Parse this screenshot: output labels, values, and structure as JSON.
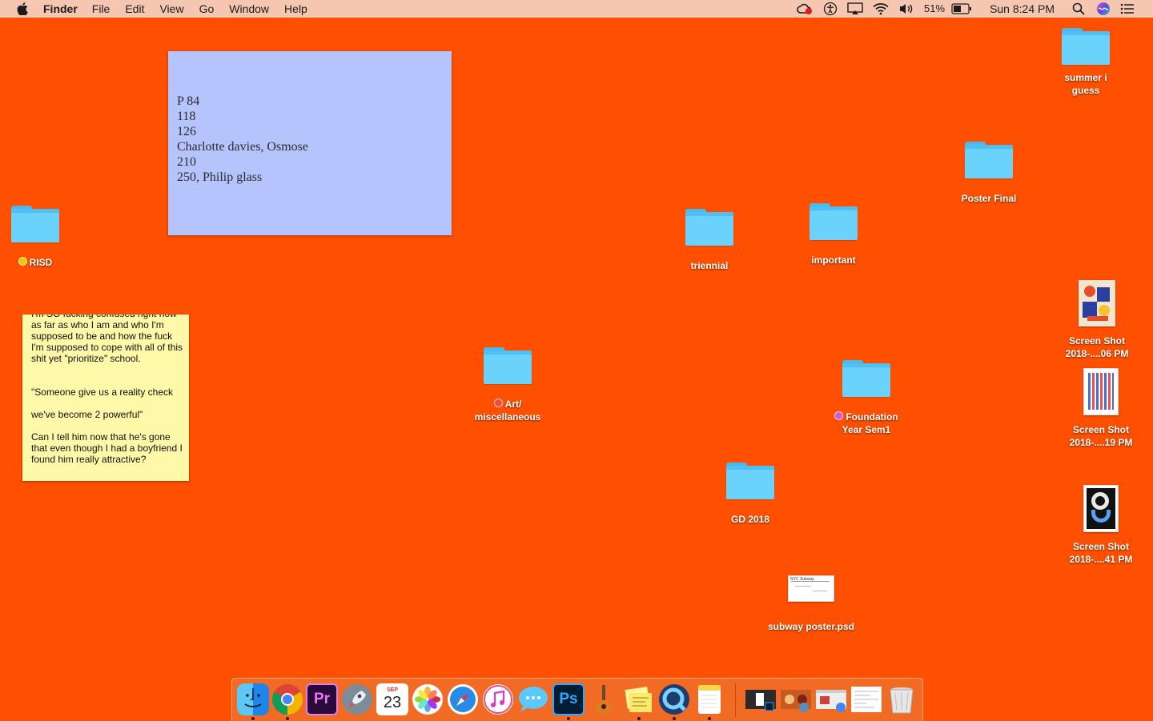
{
  "menubar": {
    "app_name": "Finder",
    "menus": [
      "File",
      "Edit",
      "View",
      "Go",
      "Window",
      "Help"
    ],
    "battery": "51%",
    "clock": "Sun 8:24 PM",
    "icons": [
      "apple-icon",
      "creative-cloud-icon",
      "accessibility-icon",
      "airplay-icon",
      "wifi-icon",
      "volume-icon",
      "battery-icon",
      "spotlight-search-icon",
      "siri-icon",
      "notification-center-icon"
    ]
  },
  "desktop": {
    "folders": {
      "summer": "summer i guess",
      "poster_final": "Poster Final",
      "risd": "RISD",
      "triennial": "triennial",
      "important": "important",
      "art": "Art/ miscellaneous",
      "foundation": "Foundation Year Sem1",
      "gd": "GD 2018"
    },
    "tag_colors": {
      "yellow": "#f6c700",
      "red": "#ef4a3c",
      "purple": "#d458d4"
    },
    "files": {
      "shot1": "Screen Shot 2018-....06 PM",
      "shot2": "Screen Shot 2018-....19 PM",
      "shot3": "Screen Shot 2018-....41 PM",
      "subway": "subway poster.psd",
      "subway_thumb_text": "NYC Subway"
    }
  },
  "stickies": {
    "blue_text": "P 84\n118\n126\nCharlotte davies, Osmose\n210\n250, Philip glass",
    "yellow_text": "I'm SO fucking confused right now as far as who I am and who I'm supposed to be and how the fuck I'm supposed to cope with all of this shit yet \"prioritize\" school.\n\n\n\"Someone give us a reality check\n\nwe've become 2 powerful\"\n\nCan I tell him now that he's gone that even though I had a boyfriend I found him really attractive?"
  },
  "dock": {
    "calendar_month": "SEP",
    "calendar_day": "23",
    "premiere_label": "Pr",
    "photoshop_label": "Ps",
    "apps": [
      "finder-icon",
      "chrome-icon",
      "premiere-icon",
      "launchpad-icon",
      "calendar-icon",
      "photos-icon",
      "safari-icon",
      "itunes-icon",
      "messages-icon",
      "photoshop-icon",
      "garageband-icon",
      "stickies-icon",
      "quicktime-icon",
      "notes-icon"
    ]
  }
}
